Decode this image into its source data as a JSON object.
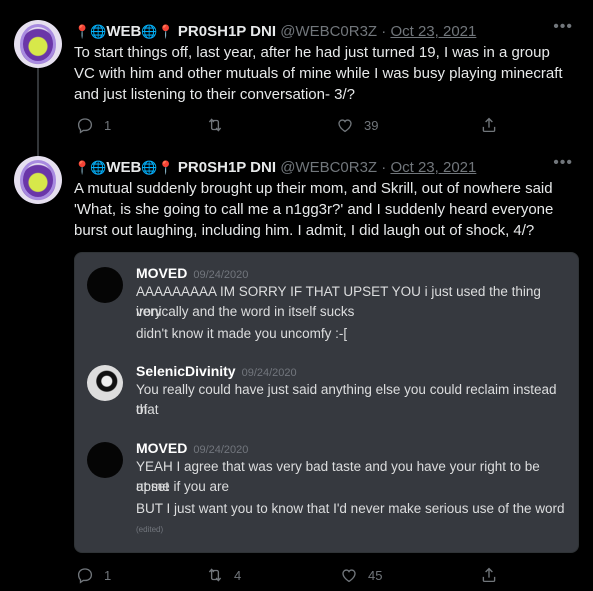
{
  "tweet1": {
    "name": "PR0SH1P DNI",
    "prefix_text": "WEB",
    "handle": "@WEBC0R3Z",
    "separator": "·",
    "date": "Oct 23, 2021",
    "text": "To start things off, last year, after he had just turned 19, I was in a group VC with him and other mutuals of mine while I was busy playing minecraft and just listening to their conversation- 3/?",
    "reply_count": "1",
    "retweet_count": "",
    "like_count": "39"
  },
  "tweet2": {
    "name": "PR0SH1P DNI",
    "prefix_text": "WEB",
    "handle": "@WEBC0R3Z",
    "separator": "·",
    "date": "Oct 23, 2021",
    "text": "A mutual suddenly brought up their mom, and Skrill, out of nowhere said 'What, is she going to call me a n1gg3r?' and I suddenly heard everyone burst out laughing, including him. I admit, I did laugh out of shock, 4/?",
    "reply_count": "1",
    "retweet_count": "4",
    "like_count": "45"
  },
  "discord": {
    "messages": [
      {
        "author": "MOVED",
        "timestamp": "09/24/2020",
        "lines": [
          "AAAAAAAAA IM SORRY IF THAT UPSET YOU i just used the thing very",
          "ironically and the word in itself sucks",
          "didn't know it made you uncomfy :-["
        ]
      },
      {
        "author": "SelenicDivinity",
        "timestamp": "09/24/2020",
        "lines": [
          "You really could have just said anything else you could reclaim instead of",
          "that"
        ]
      },
      {
        "author": "MOVED",
        "timestamp": "09/24/2020",
        "lines": [
          "YEAH I agree that was very bad taste and you have your right to be upset",
          "at me if you are",
          "BUT I just want you to know that I'd never make serious use of the word"
        ],
        "edited": "(edited)"
      }
    ]
  },
  "icons": [
    "pin-icon",
    "globe-icon",
    "more-icon",
    "reply-icon",
    "retweet-icon",
    "like-icon",
    "share-icon"
  ],
  "colors": {
    "background": "#000000",
    "text": "#e7e9ea",
    "muted": "#71767b",
    "discord_bg": "#36393f",
    "pin": "#e0245e"
  }
}
